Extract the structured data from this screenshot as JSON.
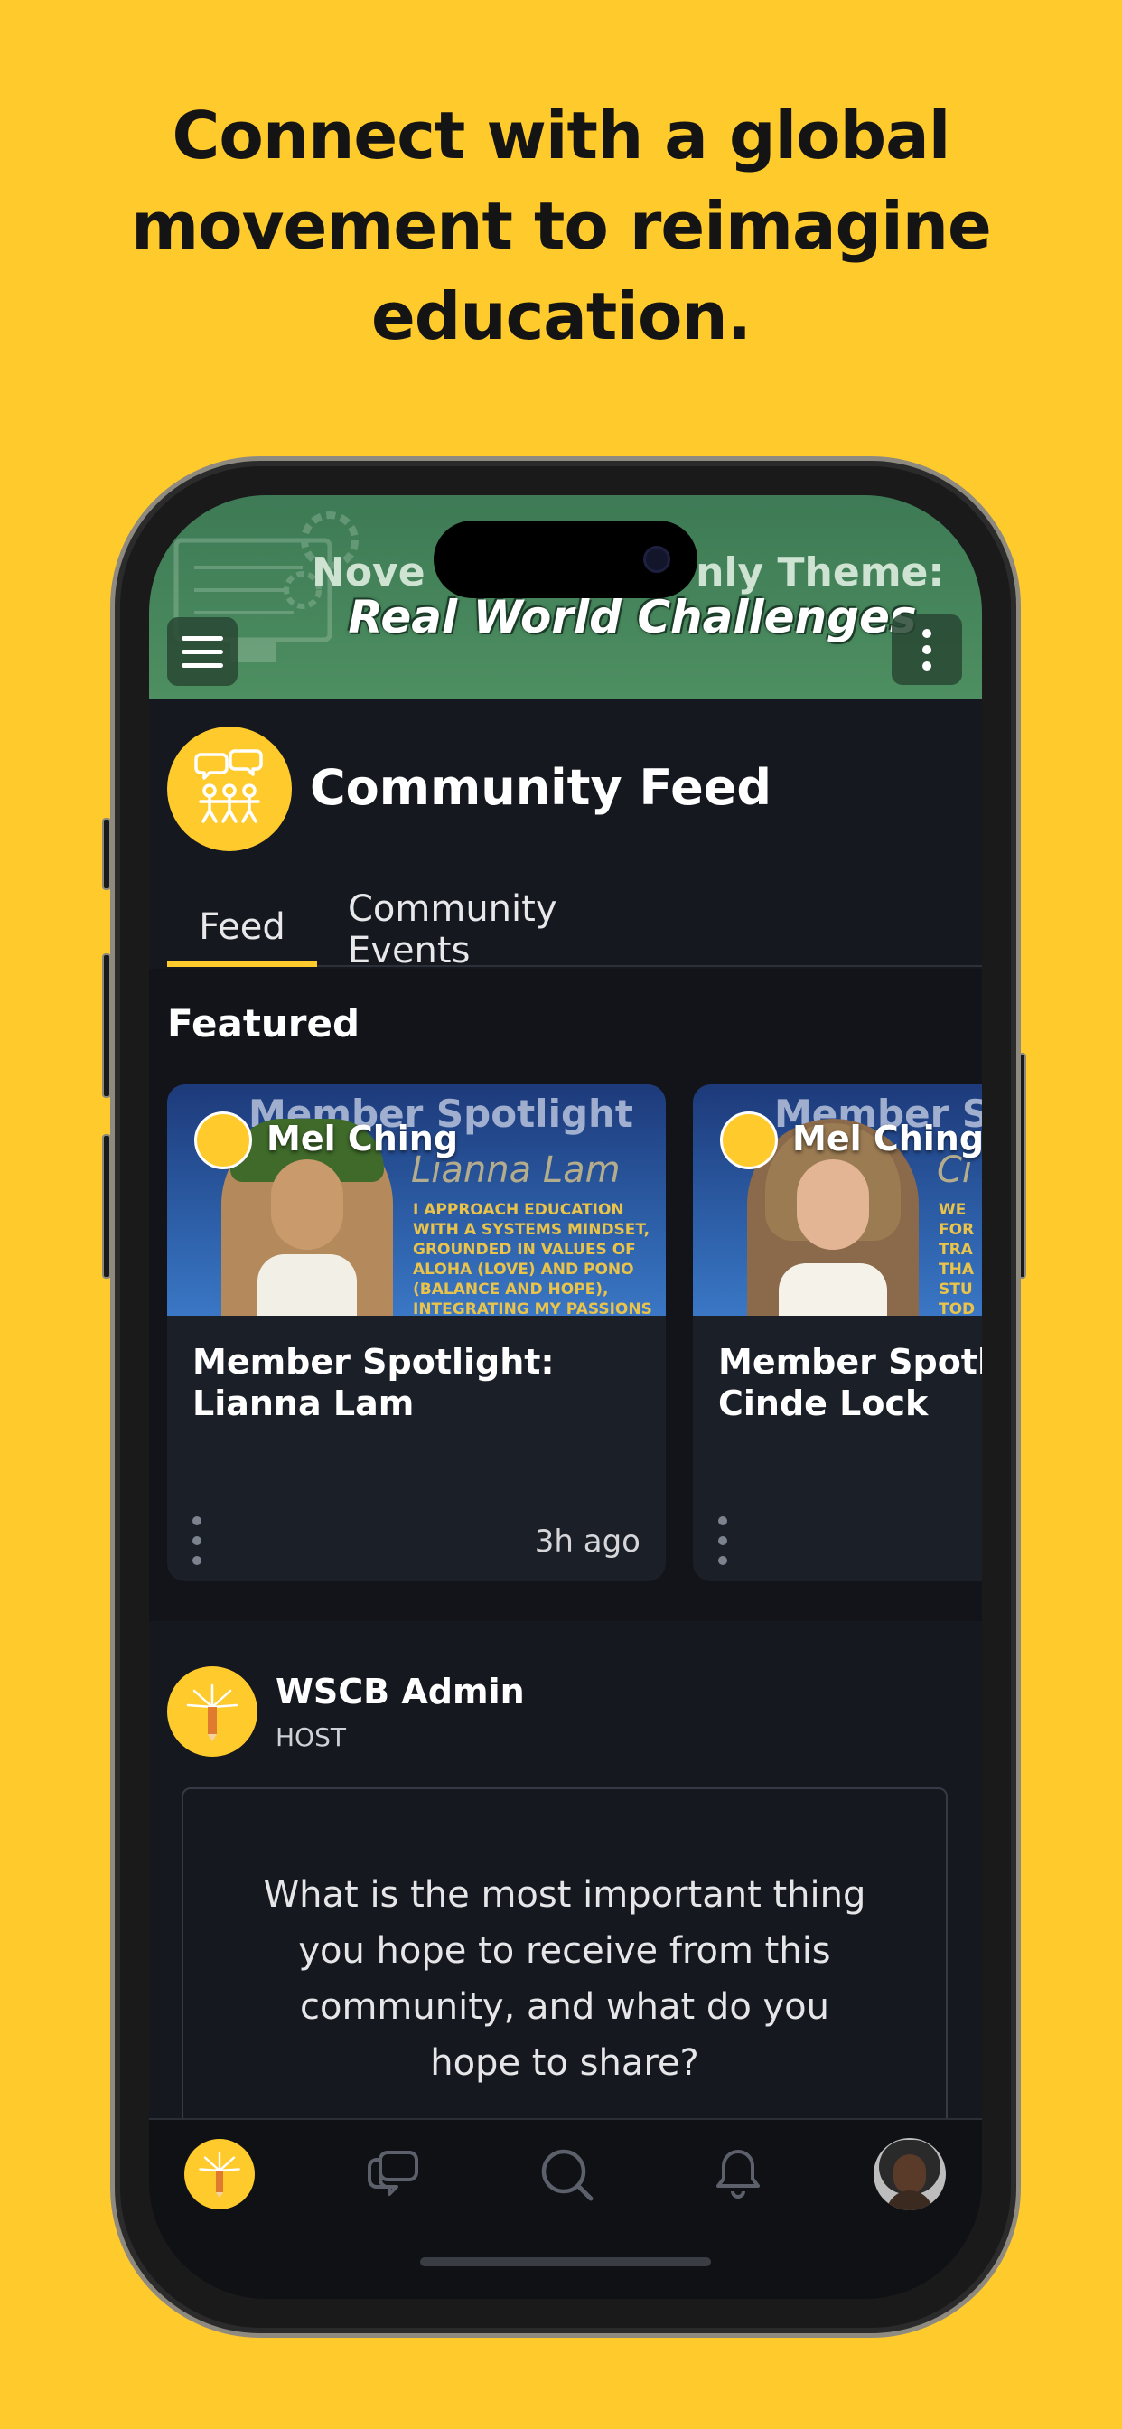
{
  "headline": {
    "line1": "Connect with a global",
    "line2": "movement to reimagine",
    "line3": "education."
  },
  "banner": {
    "theme_partial_left": "Nove",
    "theme_partial_right": "nly Theme:",
    "title": "Real World Challenges",
    "menu_icon": "hamburger-menu-icon",
    "more_icon": "more-vertical-icon"
  },
  "community": {
    "title": "Community Feed",
    "logo_icon": "community-people-icon"
  },
  "tabs": [
    {
      "label": "Feed",
      "active": true
    },
    {
      "label": "Community Events",
      "active": false
    }
  ],
  "featured": {
    "title": "Featured",
    "cards": [
      {
        "author": "Mel Ching",
        "image_title": "Member Spotlight",
        "image_name": "Lianna Lam",
        "image_text": "I APPROACH EDUCATION WITH A SYSTEMS MINDSET, GROUNDED IN VALUES OF ALOHA (LOVE) AND PONO (BALANCE AND HOPE), INTEGRATING MY PASSIONS FOR SCIENCE, COMMUNITY",
        "title_line1": "Member Spotlight:",
        "title_line2": "Lianna Lam",
        "time": "3h ago"
      },
      {
        "author": "Mel Ching",
        "image_title": "Member Spo",
        "image_name": "Ci",
        "image_text": "WE FOR TRA THA STU TOD",
        "title_line1": "Member Spotlig",
        "title_line2": "Cinde Lock",
        "time": ""
      }
    ]
  },
  "post": {
    "author": "WSCB Admin",
    "role": "HOST",
    "text": "What is the most important thing you hope to receive from this community, and what do you hope to share?"
  },
  "tabbar": {
    "items": [
      "home-icon",
      "chat-icon",
      "search-icon",
      "bell-icon",
      "profile-avatar"
    ]
  },
  "colors": {
    "brand_yellow": "#FFCA2C",
    "banner_green": "#4e8f61",
    "dark_bg": "#15181e"
  }
}
